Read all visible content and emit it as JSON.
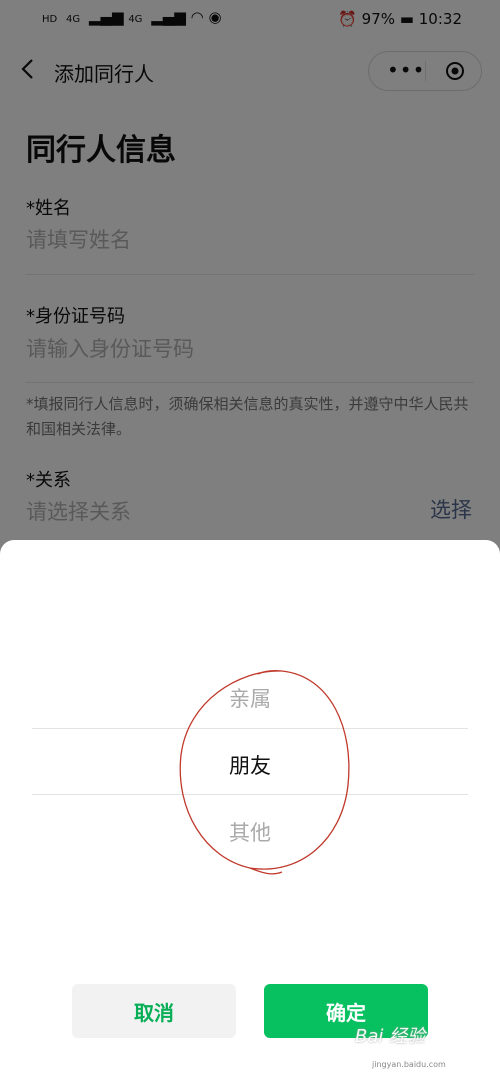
{
  "status_bar": {
    "hd1": "HD",
    "net1": "4G",
    "net2": "4G",
    "battery": "97%",
    "time": "10:32"
  },
  "navbar": {
    "title": "添加同行人",
    "more_icon": "ellipsis-icon",
    "target_icon": "target-icon"
  },
  "form": {
    "heading": "同行人信息",
    "name": {
      "label": "*姓名",
      "placeholder": "请填写姓名"
    },
    "id_number": {
      "label": "*身份证号码",
      "placeholder": "请输入身份证号码"
    },
    "notice": "*填报同行人信息时，须确保相关信息的真实性，并遵守中华人民共和国相关法律。",
    "relation": {
      "label": "*关系",
      "placeholder": "请选择关系",
      "select_label": "选择"
    }
  },
  "picker": {
    "options": [
      "亲属",
      "朋友",
      "其他"
    ],
    "selected": "朋友",
    "cancel_label": "取消",
    "confirm_label": "确定"
  },
  "watermark": {
    "text": "Bai 经验",
    "url": "jingyan.baidu.com"
  },
  "colors": {
    "accent": "#07c160",
    "link": "#576b95",
    "annotation": "#c0392b"
  }
}
